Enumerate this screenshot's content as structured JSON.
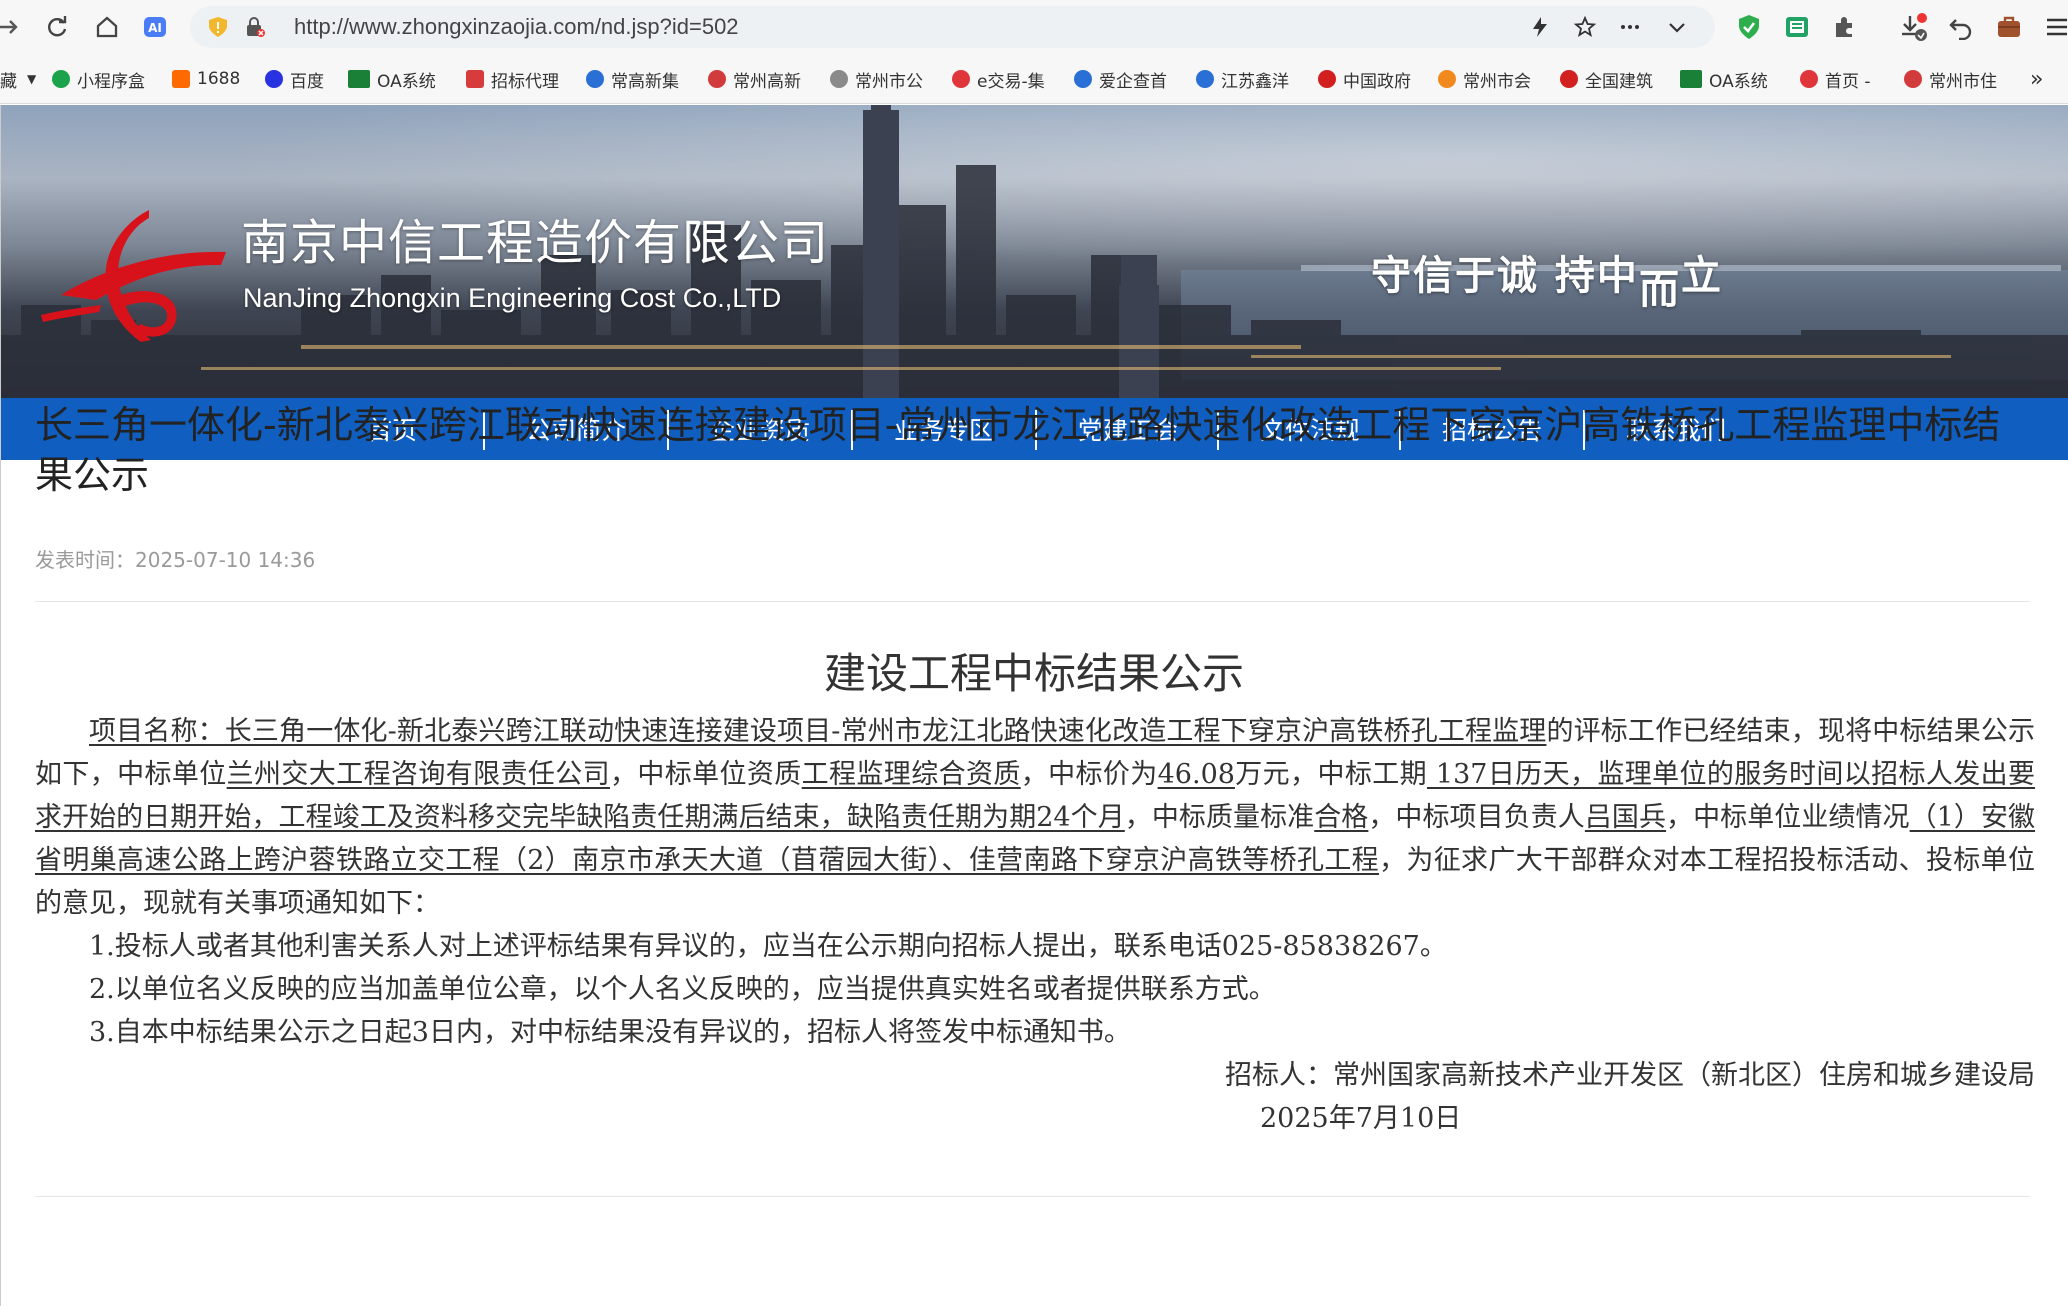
{
  "browser": {
    "url": "http://www.zhongxinzaojia.com/nd.jsp?id=502"
  },
  "bookmarks": [
    {
      "label": "藏",
      "color": "#333333"
    },
    {
      "label": "小程序盒",
      "color": "#e43b2c"
    },
    {
      "label": "1688",
      "color": "#ff6a00"
    },
    {
      "label": "百度",
      "color": "#2932e1"
    },
    {
      "label": "OA系统",
      "color": "#1a7f37"
    },
    {
      "label": "招标代理",
      "color": "#d83b3b"
    },
    {
      "label": "常高新集",
      "color": "#2a6fd6"
    },
    {
      "label": "常州高新",
      "color": "#d23b3b"
    },
    {
      "label": "常州市公",
      "color": "#777777"
    },
    {
      "label": "e交易-集",
      "color": "#e0353b"
    },
    {
      "label": "爱企查首",
      "color": "#2a6fd6"
    },
    {
      "label": "江苏鑫洋",
      "color": "#2a6fd6"
    },
    {
      "label": "中国政府",
      "color": "#d21f1f"
    },
    {
      "label": "常州市会",
      "color": "#f08a1f"
    },
    {
      "label": "全国建筑",
      "color": "#d21f1f"
    },
    {
      "label": "OA系统",
      "color": "#1a7f37"
    },
    {
      "label": "首页 -",
      "color": "#e0353b"
    },
    {
      "label": "常州市住",
      "color": "#d23b3b"
    }
  ],
  "site": {
    "company_cn": "南京中信工程造价有限公司",
    "company_en": "NanJing Zhongxin Engineering Cost Co.,LTD",
    "slogan_main": "守信于诚  持中",
    "slogan_low": "而",
    "slogan_end": "立",
    "nav": [
      "首页",
      "公司简介",
      "企业资质",
      "业务专区",
      "党建工会",
      "文件法规",
      "招标公告",
      "联系我们"
    ],
    "nav_color": "#0f5ec0"
  },
  "article": {
    "title": "长三角一体化-新北泰兴跨江联动快速连接建设项目-常州市龙江北路快速化改造工程下穿京沪高铁桥孔工程监理中标结果公示",
    "pubtime": "发表时间：2025-07-10 14:36",
    "doc_title": "建设工程中标结果公示",
    "p1_project": "项目名称：长三角一体化-新北泰兴跨江联动快速连接建设项目-常州市龙江北路快速化改造工程下穿京沪高铁桥孔工程监理",
    "p1_t1": "的评标工作已经结束，现将中标结果公示如下，中标单位",
    "p1_winner": "兰州交大工程咨询有限责任公司",
    "p1_t2": "，中标单位资质",
    "p1_qual": "工程监理综合资质",
    "p1_t3": "，中标价为",
    "p1_price": "46.08",
    "p1_t4": "万元，中标工期",
    "p1_period": " 137日历天，监理单位的服务时间以招标人发出要求开始的日期开始，工程竣工及资料移交完毕缺陷责任期满后结束，缺陷责任期为期24个月",
    "p1_t5": "，中标质量标准",
    "p1_quality": "合格",
    "p1_t6": "，中标项目负责人",
    "p1_manager": "吕国兵",
    "p1_t7": "，中标单位业绩情况",
    "p1_perf": "（1）安徽省明巢高速公路上跨沪蓉铁路立交工程（2）南京市承天大道（苜蓿园大街）、佳营南路下穿京沪高铁等桥孔工程",
    "p1_t8": "，为征求广大干部群众对本工程招投标活动、投标单位的意见，现就有关事项通知如下：",
    "items": [
      "1.投标人或者其他利害关系人对上述评标结果有异议的，应当在公示期向招标人提出，联系电话025-85838267。",
      "2.以单位名义反映的应当加盖单位公章，以个人名义反映的，应当提供真实姓名或者提供联系方式。",
      "3.自本中标结果公示之日起3日内，对中标结果没有异议的，招标人将签发中标通知书。"
    ],
    "signer": "招标人：常州国家高新技术产业开发区（新北区）住房和城乡建设局",
    "date": "2025年7月10日"
  }
}
